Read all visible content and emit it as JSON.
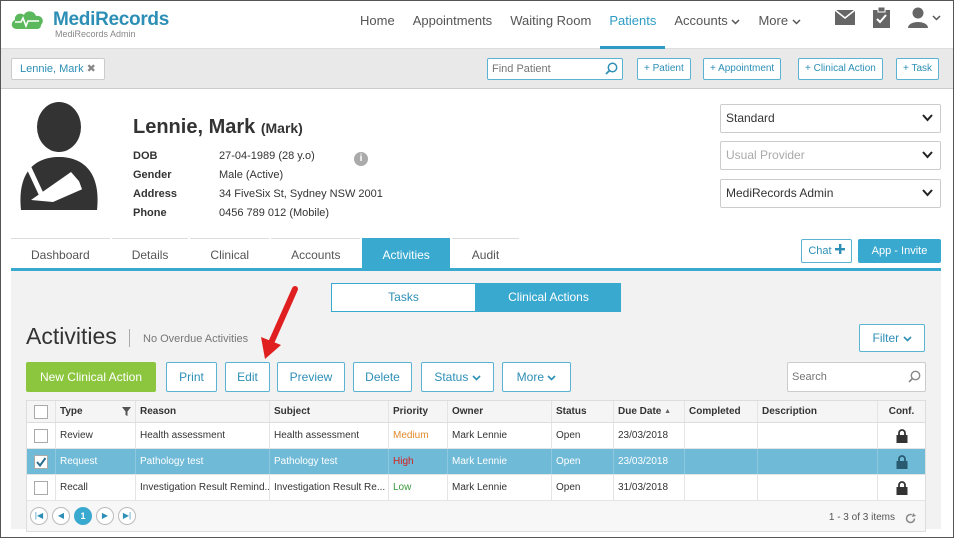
{
  "app": {
    "name": "MediRecords",
    "subtitle": "MediRecords Admin"
  },
  "nav": {
    "items": [
      {
        "label": "Home"
      },
      {
        "label": "Appointments"
      },
      {
        "label": "Waiting Room"
      },
      {
        "label": "Patients",
        "active": true
      },
      {
        "label": "Accounts",
        "dropdown": true
      },
      {
        "label": "More",
        "dropdown": true
      }
    ],
    "icons": [
      "mail-icon",
      "clipboard-check-icon",
      "user-icon"
    ]
  },
  "subbar": {
    "patient_tag": "Lennie, Mark",
    "find_placeholder": "Find Patient",
    "buttons": [
      "+ Patient",
      "+ Appointment",
      "+ Clinical Action",
      "+ Task"
    ]
  },
  "patient": {
    "name": "Lennie, Mark",
    "nickname": "(Mark)",
    "fields": [
      {
        "label": "DOB",
        "value": "27-04-1989 (28 y.o)"
      },
      {
        "label": "Gender",
        "value": "Male (Active)"
      },
      {
        "label": "Address",
        "value": "34 FiveSix St, Sydney NSW 2001"
      },
      {
        "label": "Phone",
        "value": "0456 789 012 (Mobile)"
      }
    ]
  },
  "selects": {
    "appointment_type": "Standard",
    "provider_placeholder": "Usual Provider",
    "location": "MediRecords Admin"
  },
  "tabs": [
    {
      "label": "Dashboard"
    },
    {
      "label": "Details"
    },
    {
      "label": "Clinical"
    },
    {
      "label": "Accounts"
    },
    {
      "label": "Activities",
      "active": true
    },
    {
      "label": "Audit"
    }
  ],
  "chat_label": "Chat",
  "invite_label": "App - Invite",
  "segment": {
    "left": "Tasks",
    "right": "Clinical Actions"
  },
  "activities": {
    "title": "Activities",
    "overdue": "No Overdue Activities",
    "filter_label": "Filter",
    "toolbar": {
      "new": "New Clinical Action",
      "print": "Print",
      "edit": "Edit",
      "preview": "Preview",
      "delete": "Delete",
      "status": "Status",
      "more": "More",
      "search_placeholder": "Search"
    },
    "columns": [
      "Type",
      "Reason",
      "Subject",
      "Priority",
      "Owner",
      "Status",
      "Due Date",
      "Completed",
      "Description",
      "Conf."
    ],
    "rows": [
      {
        "type": "Review",
        "reason": "Health assessment",
        "subject": "Health assessment",
        "priority": "Medium",
        "owner": "Mark Lennie",
        "status": "Open",
        "due": "23/03/2018",
        "completed": "",
        "description": "",
        "selected": false
      },
      {
        "type": "Request",
        "reason": "Pathology test",
        "subject": "Pathology test",
        "priority": "High",
        "owner": "Mark Lennie",
        "status": "Open",
        "due": "23/03/2018",
        "completed": "",
        "description": "",
        "selected": true
      },
      {
        "type": "Recall",
        "reason": "Investigation Result Remind...",
        "subject": "Investigation Result Re...",
        "priority": "Low",
        "owner": "Mark Lennie",
        "status": "Open",
        "due": "31/03/2018",
        "completed": "",
        "description": "",
        "selected": false
      }
    ],
    "pager": {
      "current_page": "1",
      "items_text": "1 - 3 of 3 items"
    }
  },
  "colors": {
    "accent": "#3aa9d0",
    "primary_button": "#8cc63f",
    "annotation_arrow": "#e02020"
  }
}
